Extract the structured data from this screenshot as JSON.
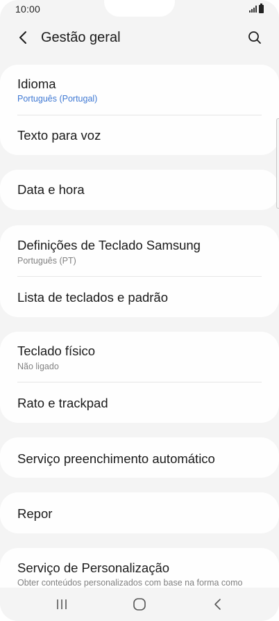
{
  "status_bar": {
    "time": "10:00"
  },
  "header": {
    "title": "Gestão geral"
  },
  "cards": [
    {
      "rows": [
        {
          "title": "Idioma",
          "subtitle": "Português (Portugal)"
        },
        {
          "title": "Texto para voz"
        }
      ]
    },
    {
      "rows": [
        {
          "title": "Data e hora"
        }
      ]
    },
    {
      "rows": [
        {
          "title": "Definições de Teclado Samsung",
          "subtitle": "Português (PT)"
        },
        {
          "title": "Lista de teclados e padrão"
        }
      ]
    },
    {
      "rows": [
        {
          "title": "Teclado físico",
          "subtitle": "Não ligado"
        },
        {
          "title": "Rato e trackpad"
        }
      ]
    },
    {
      "rows": [
        {
          "title": "Serviço preenchimento automático"
        }
      ]
    },
    {
      "rows": [
        {
          "title": "Repor"
        }
      ]
    },
    {
      "rows": [
        {
          "title": "Serviço de Personalização",
          "subtitle": "Obter conteúdos personalizados com base na forma como"
        }
      ]
    }
  ],
  "colors": {
    "accent": "#3e78d3",
    "background": "#f4f4f4",
    "card": "#fefefe"
  },
  "icons": [
    "back-arrow-icon",
    "search-icon",
    "signal-icon",
    "battery-icon",
    "recents-icon",
    "home-icon",
    "nav-back-icon"
  ]
}
